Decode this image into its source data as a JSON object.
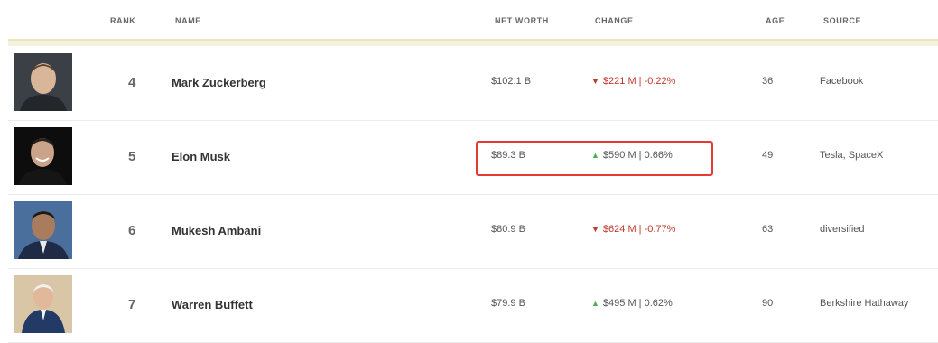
{
  "header": {
    "rank": "RANK",
    "name": "NAME",
    "net_worth": "NET WORTH",
    "change": "CHANGE",
    "age": "AGE",
    "source": "SOURCE"
  },
  "rows": [
    {
      "rank": "4",
      "name": "Mark Zuckerberg",
      "net_worth": "$102.1 B",
      "direction": "down",
      "arrow": "▼",
      "change": "$221 M | -0.22%",
      "age": "36",
      "source": "Facebook"
    },
    {
      "rank": "5",
      "name": "Elon Musk",
      "net_worth": "$89.3 B",
      "direction": "up",
      "arrow": "▲",
      "change": "$590 M | 0.66%",
      "age": "49",
      "source": "Tesla, SpaceX"
    },
    {
      "rank": "6",
      "name": "Mukesh Ambani",
      "net_worth": "$80.9 B",
      "direction": "down",
      "arrow": "▼",
      "change": "$624 M | -0.77%",
      "age": "63",
      "source": "diversified"
    },
    {
      "rank": "7",
      "name": "Warren Buffett",
      "net_worth": "$79.9 B",
      "direction": "up",
      "arrow": "▲",
      "change": "$495 M | 0.62%",
      "age": "90",
      "source": "Berkshire Hathaway"
    }
  ],
  "colors": {
    "down": "#c0392b",
    "up_arrow": "#4caf50",
    "highlight_border": "#e53935",
    "band": "#f5f3dd"
  }
}
